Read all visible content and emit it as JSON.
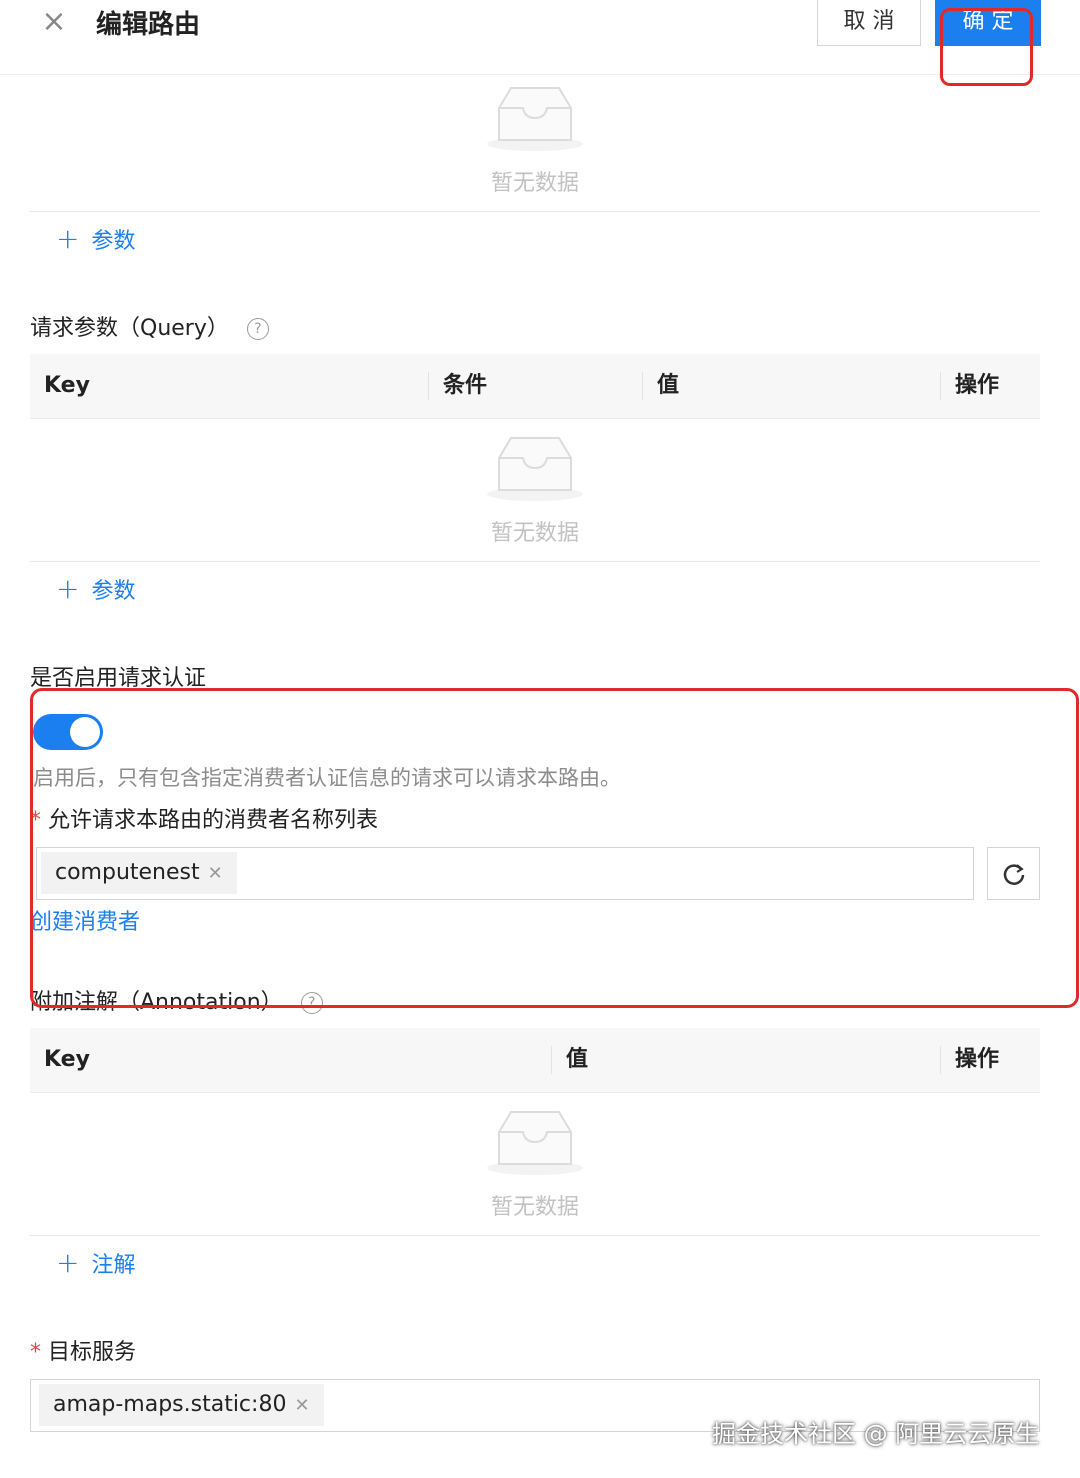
{
  "header": {
    "title": "编辑路由",
    "cancel_label": "取 消",
    "confirm_label": "确 定"
  },
  "empty_text": "暂无数据",
  "header_params_section": {
    "add_label": "参数"
  },
  "query_section": {
    "label": "请求参数（Query）",
    "columns": [
      "Key",
      "条件",
      "值",
      "操作"
    ],
    "add_label": "参数"
  },
  "auth_section": {
    "label": "是否启用请求认证",
    "enabled": true,
    "hint": "启用后，只有包含指定消费者认证信息的请求可以请求本路由。",
    "consumer_label": "允许请求本路由的消费者名称列表",
    "consumer_tags": [
      "computenest"
    ],
    "create_consumer_link": "创建消费者"
  },
  "annotation_section": {
    "label": "附加注解（Annotation）",
    "columns": [
      "Key",
      "值",
      "操作"
    ],
    "add_label": "注解"
  },
  "target_section": {
    "label": "目标服务",
    "tags": [
      "amap-maps.static:80"
    ]
  },
  "watermark": "掘金技术社区 @ 阿里云云原生",
  "colors": {
    "accent": "#1b7ff0",
    "highlight": "#e02a2a",
    "required": "#f04040"
  },
  "icons": {
    "close": "close-icon",
    "help": "question-circle-icon",
    "empty": "inbox-empty-icon",
    "refresh": "refresh-icon",
    "remove_tag": "tag-close-icon",
    "add": "plus-icon"
  }
}
